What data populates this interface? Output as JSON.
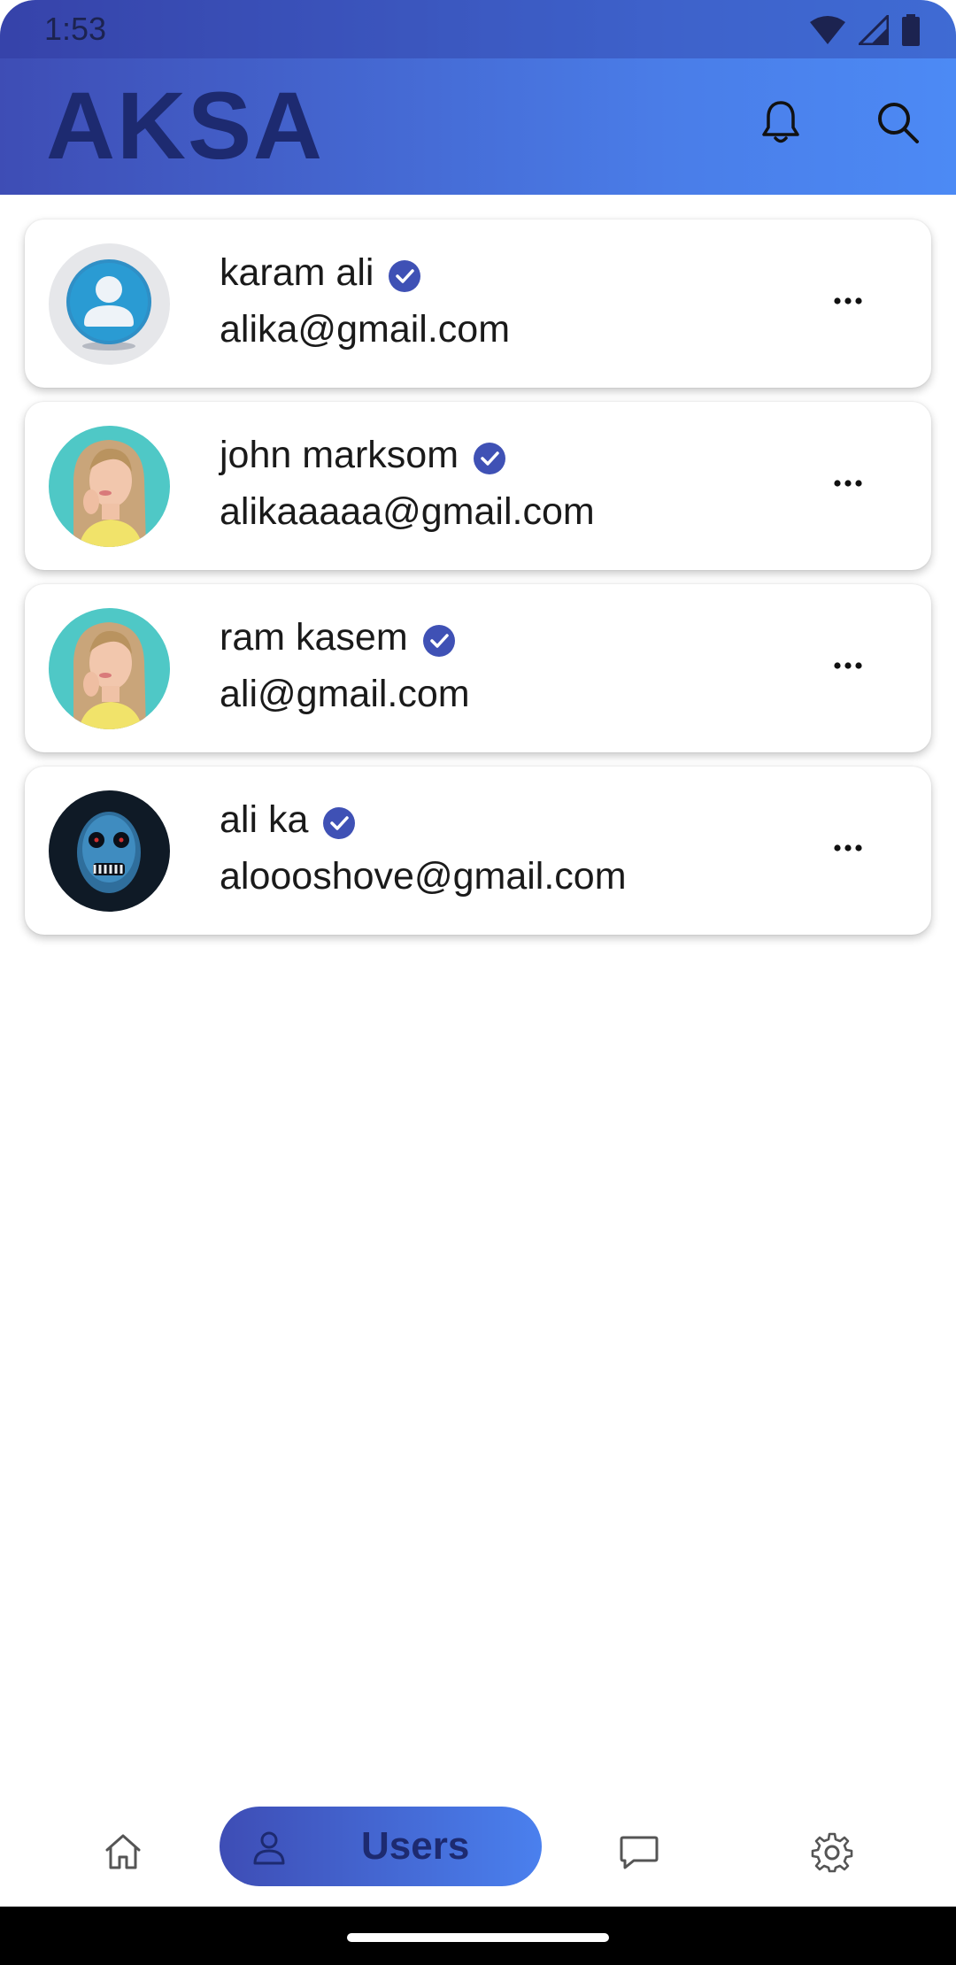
{
  "status_bar": {
    "time": "1:53",
    "icons": [
      "wifi-icon",
      "cellular-signal-icon",
      "battery-icon"
    ]
  },
  "app_bar": {
    "title": "AKSA",
    "actions": [
      "bell-icon",
      "search-icon"
    ]
  },
  "users": [
    {
      "name": "karam ali",
      "email": "alika@gmail.com",
      "verified": true,
      "avatar": "default-avatar"
    },
    {
      "name": "john marksom",
      "email": "alikaaaaa@gmail.com",
      "verified": true,
      "avatar": "woman-photo"
    },
    {
      "name": "ram kasem",
      "email": "ali@gmail.com",
      "verified": true,
      "avatar": "woman-photo"
    },
    {
      "name": "ali ka",
      "email": "aloooshove@gmail.com",
      "verified": true,
      "avatar": "skull-mask-photo"
    }
  ],
  "bottom_nav": {
    "items": [
      "home-icon",
      "users-icon",
      "chat-icon",
      "settings-icon"
    ],
    "active": "Users",
    "active_label": "Users"
  },
  "colors": {
    "primary": "#3e4db5",
    "accent": "#4c8af5",
    "verified": "#3f51b5",
    "title": "#1d2a70"
  }
}
